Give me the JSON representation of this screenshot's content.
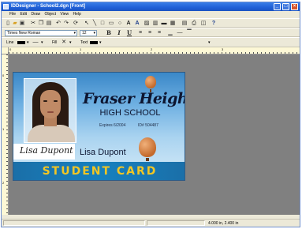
{
  "window": {
    "title": "IDDesigner - School2.dgn   [Front]",
    "controls": [
      "minimize",
      "maximize",
      "close"
    ]
  },
  "menu": [
    "File",
    "Edit",
    "Draw",
    "Object",
    "View",
    "Help"
  ],
  "toolbar_main": {
    "icons": [
      "new-icon",
      "open-icon",
      "save-icon",
      "cut-icon",
      "copy-icon",
      "paste-icon",
      "undo-icon",
      "redo-icon",
      "refresh-icon",
      "pointer-icon",
      "line-icon",
      "rectangle-icon",
      "rounded-rectangle-icon",
      "ellipse-icon",
      "text-icon",
      "logo-icon",
      "image-icon",
      "barcode-icon",
      "field-icon",
      "grid-icon",
      "database-icon",
      "print-icon",
      "help-icon"
    ]
  },
  "toolbar_format": {
    "font": "Times New Roman",
    "size": "12",
    "bold": "B",
    "italic": "I",
    "underline": "U"
  },
  "toolbar_style": {
    "line_label": "Line",
    "fill_label": "Fill",
    "text_label": "Text"
  },
  "card": {
    "school_name": "Fraser Heights",
    "school_type": "HIGH SCHOOL",
    "expires": "Expires 6/2004",
    "id_number": "ID# 504487",
    "signature": "Lisa Dupont",
    "student_name": "Lisa Dupont",
    "banner": "STUDENT CARD"
  },
  "status": {
    "coords": "4.000 in, 2.400 in"
  }
}
